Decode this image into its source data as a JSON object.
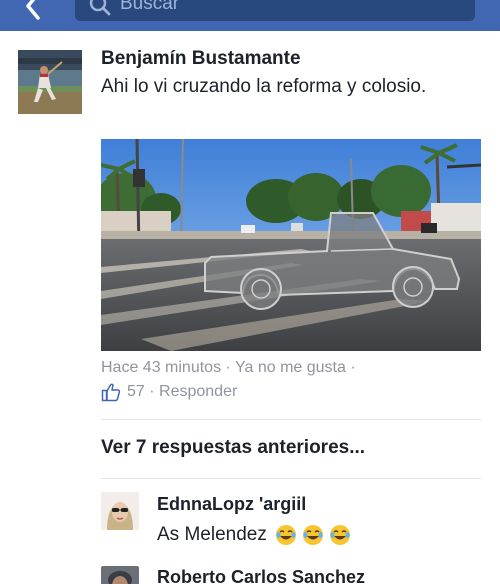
{
  "topbar": {
    "search_placeholder": "Buscar",
    "color": "#4267b2"
  },
  "post": {
    "author": "Benjamín Bustamante",
    "text": "Ahi lo vi cruzando la reforma y colosio.",
    "time": "Hace 43 minutos",
    "unlike_label": "Ya no me gusta",
    "like_count": "57",
    "reply_label": "Responder",
    "separator": "·"
  },
  "replies": {
    "view_previous": "Ver 7 respuestas anteriores...",
    "items": [
      {
        "name": "EdnnaLopz 'argiil",
        "text": "As Melendez",
        "emojis": [
          "joy-emoji",
          "joy-emoji",
          "joy-emoji"
        ]
      },
      {
        "name": "Roberto Carlos Sanchez",
        "text": ""
      }
    ]
  },
  "colors": {
    "meta_gray": "#90949c",
    "like_blue": "#4267b2"
  }
}
